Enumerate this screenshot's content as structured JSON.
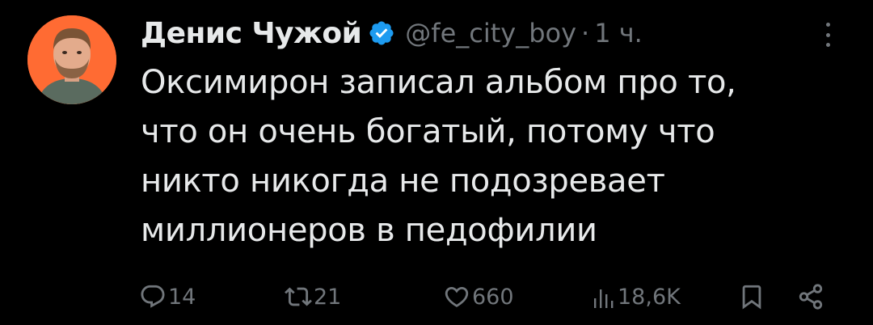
{
  "author": {
    "display_name": "Денис Чужой",
    "verified": true,
    "handle": "@fe_city_boy",
    "separator": "·",
    "time": "1 ч.",
    "avatar_bg": "#ff6b33"
  },
  "tweet": {
    "lines": [
      "Оксимирон записал альбом про то,",
      "что он очень богатый, потому что",
      "никто никогда не подозревает",
      "миллионеров в педофилии"
    ]
  },
  "actions": {
    "replies": "14",
    "reposts": "21",
    "likes": "660",
    "views": "18,6K"
  },
  "colors": {
    "background": "#000000",
    "text": "#e7e9ea",
    "secondary": "#71767b",
    "verified": "#1d9bf0"
  }
}
